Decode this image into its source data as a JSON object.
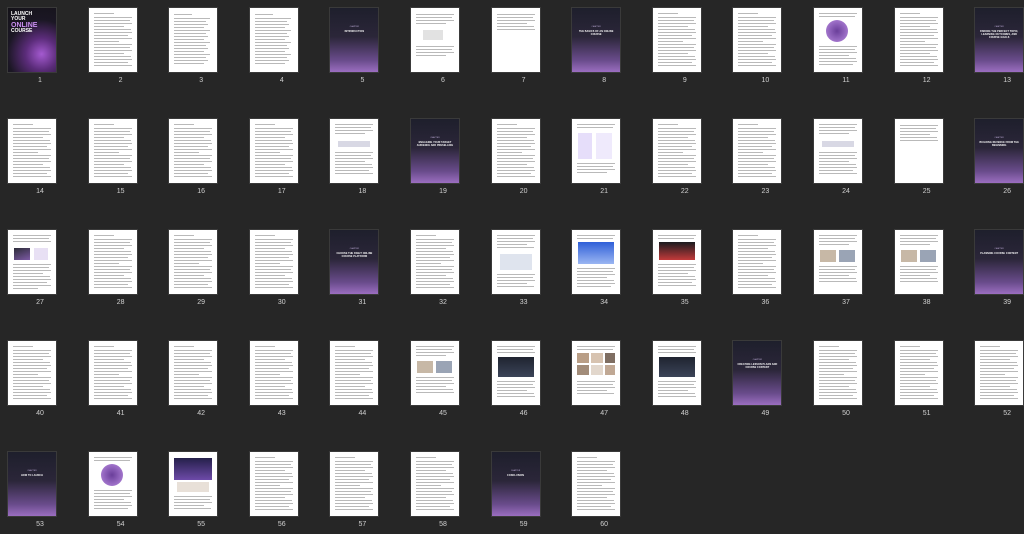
{
  "viewer": {
    "background": "#262626"
  },
  "cover": {
    "line1": "LAUNCH",
    "line2": "YOUR",
    "line3": "ONLINE",
    "line4": "COURSE"
  },
  "chapter_label": "CHAPTER",
  "pages": [
    {
      "number": "1",
      "type": "cover"
    },
    {
      "number": "2",
      "type": "text"
    },
    {
      "number": "3",
      "type": "toc"
    },
    {
      "number": "4",
      "type": "toc"
    },
    {
      "number": "5",
      "type": "divider",
      "title": "INTRODUCTION"
    },
    {
      "number": "6",
      "type": "diagram"
    },
    {
      "number": "7",
      "type": "text-short"
    },
    {
      "number": "8",
      "type": "divider",
      "title": "THE BASICS OF AN ONLINE COURSE"
    },
    {
      "number": "9",
      "type": "text"
    },
    {
      "number": "10",
      "type": "text"
    },
    {
      "number": "11",
      "type": "circle-figure"
    },
    {
      "number": "12",
      "type": "text"
    },
    {
      "number": "13",
      "type": "divider",
      "title": "FINDING THE PERFECT TOPIC, LEARNING OUTCOMES, AND COURSE GOALS"
    },
    {
      "number": "14",
      "type": "text"
    },
    {
      "number": "15",
      "type": "text"
    },
    {
      "number": "16",
      "type": "text"
    },
    {
      "number": "17",
      "type": "text"
    },
    {
      "number": "18",
      "type": "flow"
    },
    {
      "number": "19",
      "type": "divider",
      "title": "ENGAGING YOUR TARGET AUDIENCE AND PRESELLING"
    },
    {
      "number": "20",
      "type": "text"
    },
    {
      "number": "21",
      "type": "boxes"
    },
    {
      "number": "22",
      "type": "text"
    },
    {
      "number": "23",
      "type": "text"
    },
    {
      "number": "24",
      "type": "flow"
    },
    {
      "number": "25",
      "type": "text-short"
    },
    {
      "number": "26",
      "type": "divider",
      "title": "BUILDING REVENUE FROM THE BEGINNING"
    },
    {
      "number": "27",
      "type": "pyramid"
    },
    {
      "number": "28",
      "type": "text"
    },
    {
      "number": "29",
      "type": "text"
    },
    {
      "number": "30",
      "type": "text"
    },
    {
      "number": "31",
      "type": "divider",
      "title": "CHOOSE THE RIGHT ONLINE COURSE PLATFORM"
    },
    {
      "number": "32",
      "type": "text"
    },
    {
      "number": "33",
      "type": "screens"
    },
    {
      "number": "34",
      "type": "screenshot-blue"
    },
    {
      "number": "35",
      "type": "screenshot-red"
    },
    {
      "number": "36",
      "type": "text"
    },
    {
      "number": "37",
      "type": "photos"
    },
    {
      "number": "38",
      "type": "photos"
    },
    {
      "number": "39",
      "type": "divider",
      "title": "PLANNING COURSE CONTENT"
    },
    {
      "number": "40",
      "type": "text"
    },
    {
      "number": "41",
      "type": "text"
    },
    {
      "number": "42",
      "type": "text"
    },
    {
      "number": "43",
      "type": "text"
    },
    {
      "number": "44",
      "type": "text"
    },
    {
      "number": "45",
      "type": "photos"
    },
    {
      "number": "46",
      "type": "screenshot-dark"
    },
    {
      "number": "47",
      "type": "collage"
    },
    {
      "number": "48",
      "type": "screenshot-dark"
    },
    {
      "number": "49",
      "type": "divider",
      "title": "CREATING LESSON PLANS AND COURSE CONTENT"
    },
    {
      "number": "50",
      "type": "text"
    },
    {
      "number": "51",
      "type": "text"
    },
    {
      "number": "52",
      "type": "text"
    },
    {
      "number": "53",
      "type": "divider",
      "title": "HOW TO LAUNCH"
    },
    {
      "number": "54",
      "type": "circle-figure"
    },
    {
      "number": "55",
      "type": "screenshot-promo"
    },
    {
      "number": "56",
      "type": "text"
    },
    {
      "number": "57",
      "type": "text"
    },
    {
      "number": "58",
      "type": "text"
    },
    {
      "number": "59",
      "type": "divider",
      "title": "CONCLUSION"
    },
    {
      "number": "60",
      "type": "text"
    }
  ]
}
